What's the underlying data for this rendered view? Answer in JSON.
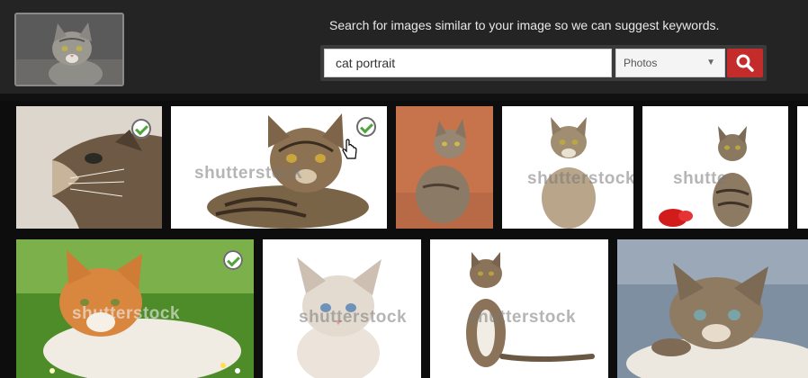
{
  "header": {
    "query_image_alt": "uploaded cat image",
    "hint": "Search for images similar to your image so we can suggest keywords.",
    "search": {
      "value": "cat portrait",
      "type_selected": "Photos"
    }
  },
  "results": {
    "row1": [
      {
        "name": "result-1",
        "checked": true,
        "watermark": ""
      },
      {
        "name": "result-2",
        "checked": true,
        "watermark": "shutterstock"
      },
      {
        "name": "result-3",
        "checked": false,
        "watermark": ""
      },
      {
        "name": "result-4",
        "checked": false,
        "watermark": "shutterstock"
      },
      {
        "name": "result-5",
        "checked": false,
        "watermark": "shutte"
      }
    ],
    "row2": [
      {
        "name": "result-7",
        "checked": true,
        "watermark": "shutterstock"
      },
      {
        "name": "result-8",
        "checked": false,
        "watermark": "shutterstock"
      },
      {
        "name": "result-9",
        "checked": false,
        "watermark": "shutterstock"
      },
      {
        "name": "result-10",
        "checked": false,
        "watermark": ""
      }
    ]
  },
  "colors": {
    "accent_red": "#c42b2b",
    "check_green": "#4ea63a",
    "header_bg": "#242424"
  },
  "icons": [
    "search-icon",
    "chevron-down-icon",
    "checkmark-icon",
    "hand-cursor-icon"
  ]
}
